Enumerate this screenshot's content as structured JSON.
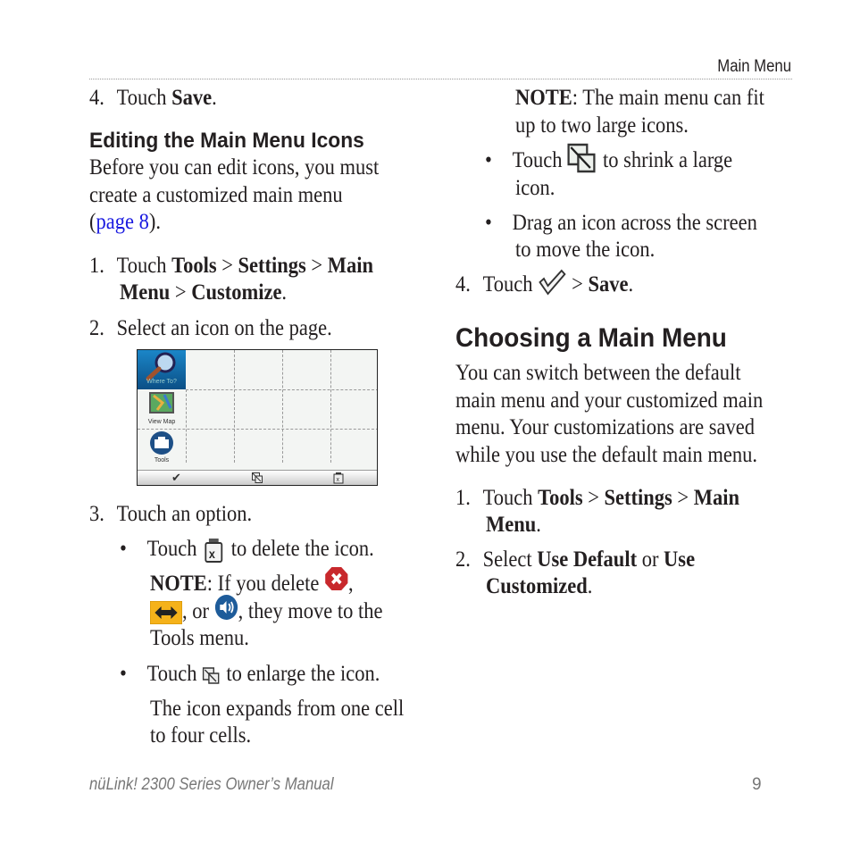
{
  "header": {
    "section": "Main Menu"
  },
  "left": {
    "step4": {
      "num": "4.",
      "pre": "Touch ",
      "bold": "Save",
      "post": "."
    },
    "heading": "Editing the Main Menu Icons",
    "intro": [
      "Before you can edit icons, you must",
      "create a customized main menu"
    ],
    "intro_link_pre": "(",
    "intro_link": "page 8",
    "intro_link_post": ").",
    "step1": {
      "num": "1.",
      "pre": "Touch ",
      "b1": "Tools",
      "s1": " > ",
      "b2": "Settings",
      "s2": " > ",
      "b3": "Main",
      "b4": "Menu",
      "s3": " > ",
      "b5": "Customize",
      "post": "."
    },
    "step2": {
      "num": "2.",
      "text": "Select an icon on the page."
    },
    "screenshot": {
      "tools": [
        {
          "label": "Where To?",
          "icon": "magnifier-icon"
        },
        {
          "label": "View Map",
          "icon": "map-icon"
        },
        {
          "label": "Tools",
          "icon": "toolbox-icon"
        }
      ]
    },
    "step3": {
      "num": "3.",
      "text": "Touch an option."
    },
    "bullet_delete": {
      "pre": "Touch ",
      "post": " to delete the icon."
    },
    "note1": {
      "label": "NOTE",
      "t1": ": If you delete ",
      "t2": ",",
      "t3": ", or ",
      "t4": ", they move to the",
      "t5": "Tools menu."
    },
    "bullet_enlarge": {
      "pre": "Touch ",
      "post": " to enlarge the icon."
    },
    "expand": [
      "The icon expands from one cell",
      "to four cells."
    ]
  },
  "right": {
    "note2": {
      "label": "NOTE",
      "t1": ": The main menu can fit",
      "t2": "up to two large icons."
    },
    "bullet_shrink": {
      "pre": "Touch ",
      "post": " to shrink a large",
      "line2": "icon."
    },
    "bullet_drag": [
      "Drag an icon across the screen",
      "to move the icon."
    ],
    "step4": {
      "num": "4.",
      "pre": "Touch ",
      "mid": " > ",
      "bold": "Save",
      "post": "."
    },
    "heading": "Choosing a Main Menu",
    "body": [
      "You can switch between the default",
      "main menu and your customized main",
      "menu. Your customizations are saved",
      "while you use the default main menu."
    ],
    "step1": {
      "num": "1.",
      "pre": "Touch ",
      "b1": "Tools",
      "s1": " > ",
      "b2": "Settings",
      "s2": " > ",
      "b3": "Main",
      "b4": "Menu",
      "post": "."
    },
    "step2": {
      "num": "2.",
      "pre": "Select ",
      "b1": "Use Default",
      "mid": " or ",
      "b2": "Use",
      "b3": "Customized",
      "post": "."
    }
  },
  "footer": {
    "title": "nüLink! 2300 Series Owner’s Manual",
    "page": "9"
  },
  "bullet": "•"
}
